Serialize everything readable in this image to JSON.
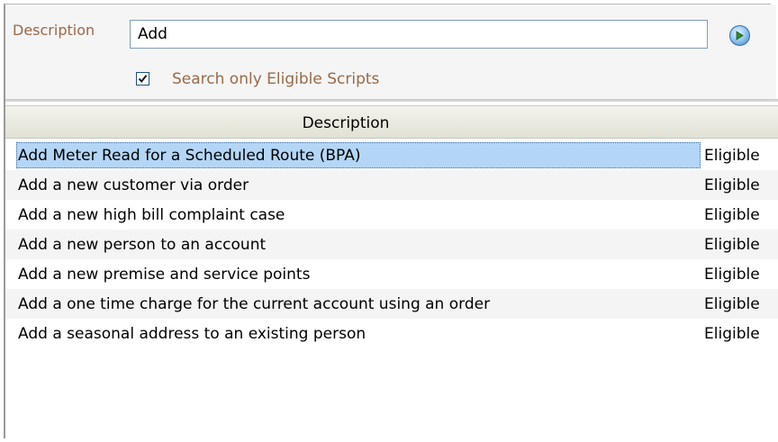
{
  "search": {
    "label": "Description",
    "value": "Add",
    "go_icon": "play-circle-icon",
    "checkbox_checked": true,
    "checkbox_label": "Search only Eligible Scripts"
  },
  "grid": {
    "header": "Description",
    "rows": [
      {
        "description": "Add Meter Read for a Scheduled Route (BPA)",
        "status": "Eligible",
        "selected": true
      },
      {
        "description": "Add a new customer via order",
        "status": "Eligible"
      },
      {
        "description": "Add a new high bill complaint case",
        "status": "Eligible"
      },
      {
        "description": "Add a new person to an account",
        "status": "Eligible"
      },
      {
        "description": "Add a new premise and service points",
        "status": "Eligible"
      },
      {
        "description": "Add a one time charge for the current account using an order",
        "status": "Eligible"
      },
      {
        "description": "Add a seasonal address to an existing person",
        "status": "Eligible"
      }
    ]
  },
  "colors": {
    "label_text": "#9a6a48",
    "selected_row": "#b4d6f6",
    "header_bg": "#e9e8df",
    "alt_row": "#f4f4f4"
  }
}
